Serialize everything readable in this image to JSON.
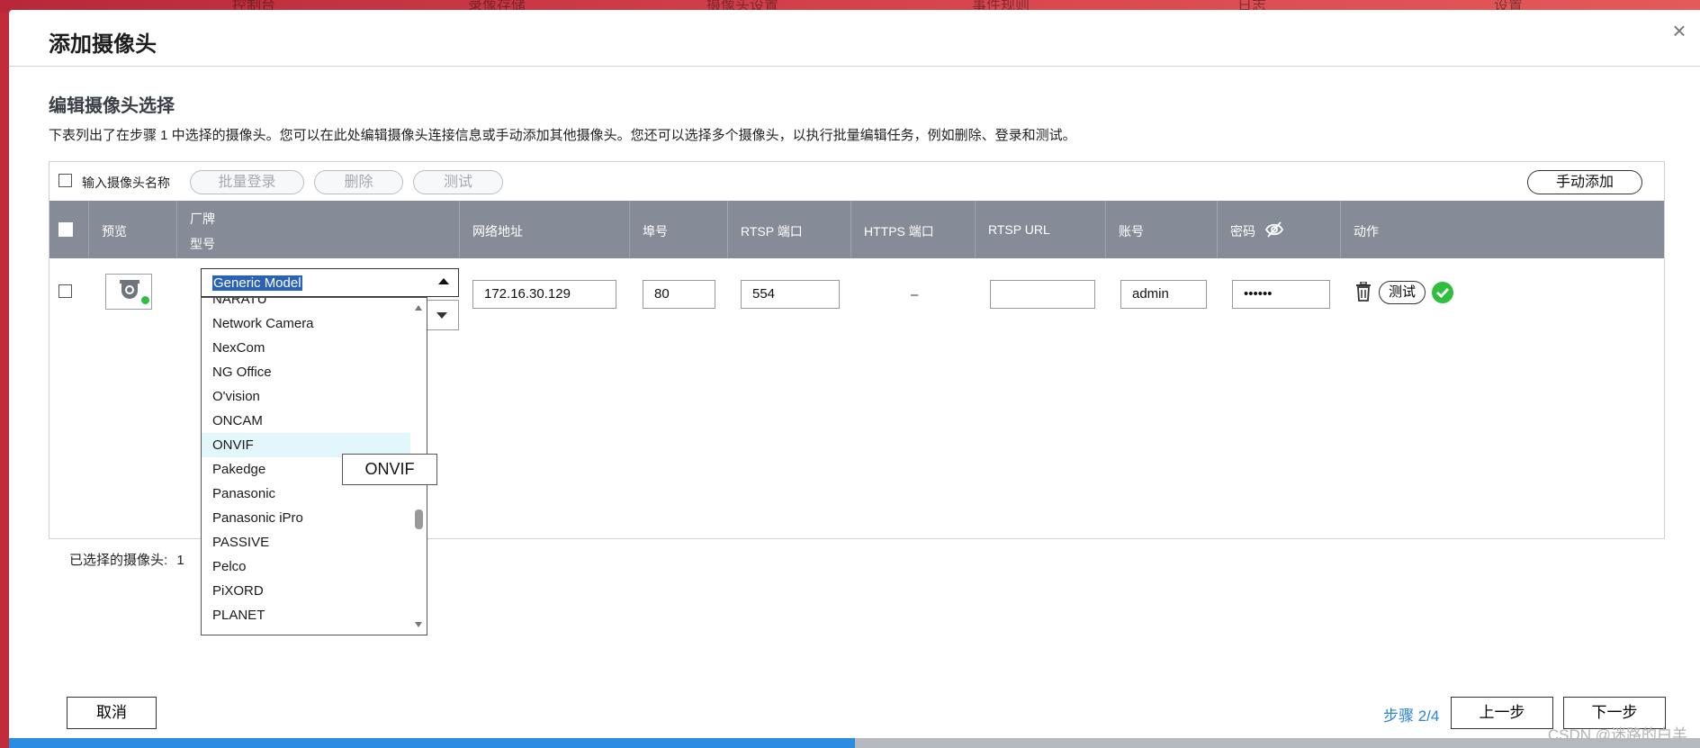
{
  "dialog": {
    "title": "添加摄像头",
    "close_glyph": "×"
  },
  "section": {
    "title": "编辑摄像头选择",
    "description": "下表列出了在步骤 1 中选择的摄像头。您可以在此处编辑摄像头连接信息或手动添加其他摄像头。您还可以选择多个摄像头，以执行批量编辑任务，例如删除、登录和测试。"
  },
  "toolbar": {
    "name_label": "输入摄像头名称",
    "batch_login": "批量登录",
    "delete": "删除",
    "test": "测试",
    "manual_add": "手动添加"
  },
  "table": {
    "headers": {
      "preview": "预览",
      "brand": "厂牌",
      "model": "型号",
      "address": "网络地址",
      "port": "埠号",
      "rtsp_port": "RTSP 端口",
      "https_port": "HTTPS 端口",
      "rtsp_url": "RTSP URL",
      "account": "账号",
      "password": "密码",
      "action": "动作"
    },
    "row": {
      "model_selected": "Generic Model",
      "address": "172.16.30.129",
      "port": "80",
      "rtsp_port": "554",
      "https_port": "–",
      "rtsp_url": "",
      "account": "admin",
      "password": "••••••",
      "test": "测试"
    }
  },
  "dropdown": {
    "partial_top": "NARATU",
    "items": [
      "Network Camera",
      "NexCom",
      "NG Office",
      "O'vision",
      "ONCAM",
      "ONVIF",
      "Pakedge",
      "Panasonic",
      "Panasonic iPro",
      "PASSIVE",
      "Pelco",
      "PiXORD",
      "PLANET"
    ],
    "highlighted": "ONVIF",
    "tooltip": "ONVIF"
  },
  "footer": {
    "selected_label": "已选择的摄像头:",
    "selected_count": "1",
    "cancel": "取消",
    "step": "步骤 2/4",
    "prev": "上一步",
    "next": "下一步",
    "progress": 0.5
  },
  "background_tabs": [
    "控制台",
    "录像存储",
    "摄像头设置",
    "事件规则",
    "日志",
    "设置"
  ],
  "watermark": "CSDN @迷路的白羊",
  "colors": {
    "header_bg": "#858c98",
    "accent_blue": "#2b84d8",
    "ok_green": "#2fbf3e",
    "highlight": "#e2f7fb",
    "selection": "#2a62b8"
  }
}
